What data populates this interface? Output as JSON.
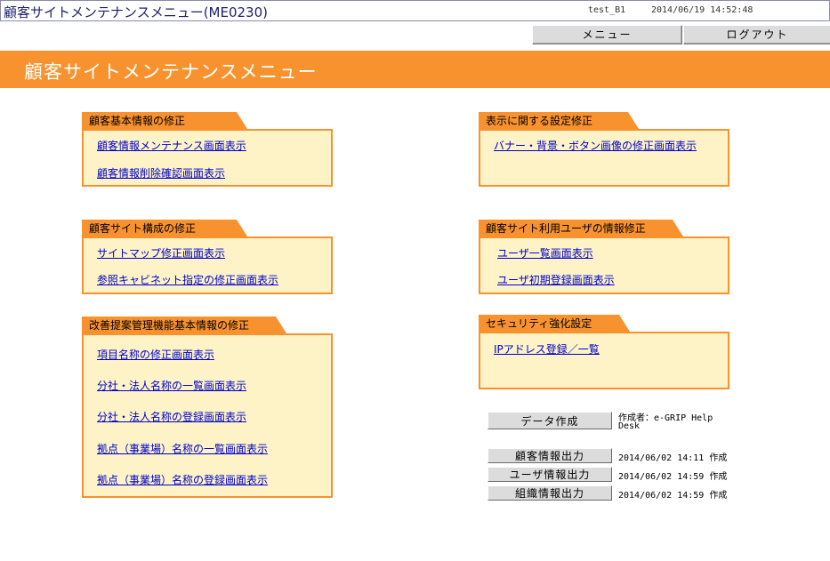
{
  "header": {
    "title": "顧客サイトメンテナンスメニュー(ME0230)",
    "user": "test_B1",
    "datetime": "2014/06/19  14:52:48"
  },
  "nav": {
    "menu_label": "メニュー",
    "logout_label": "ログアウト"
  },
  "page_title": "顧客サイトメンテナンスメニュー",
  "sections": {
    "customer_basic": {
      "title": "顧客基本情報の修正",
      "links": [
        "顧客情報メンテナンス画面表示",
        "顧客情報削除確認画面表示"
      ]
    },
    "site_structure": {
      "title": "顧客サイト構成の修正",
      "links": [
        "サイトマップ修正画面表示",
        "参照キャビネット指定の修正画面表示"
      ]
    },
    "kaizen": {
      "title": "改善提案管理機能基本情報の修正",
      "links": [
        "項目名称の修正画面表示",
        "分社・法人名称の一覧画面表示",
        "分社・法人名称の登録画面表示",
        "拠点（事業場）名称の一覧画面表示",
        "拠点（事業場）名称の登録画面表示"
      ]
    },
    "display": {
      "title": "表示に関する設定修正",
      "links": [
        "バナー・背景・ボタン画像の修正画面表示"
      ]
    },
    "users": {
      "title": "顧客サイト利用ユーザの情報修正",
      "links": [
        "ユーザ一覧画面表示",
        "ユーザ初期登録画面表示"
      ]
    },
    "security": {
      "title": "セキュリティ強化設定",
      "links": [
        "IPアドレス登録／一覧"
      ]
    }
  },
  "data_output": {
    "create_label": "データ作成",
    "creator_line1": "作成者：e-GRIP Help",
    "creator_line2": "Desk",
    "rows": [
      {
        "label": "顧客情報出力",
        "info": "2014/06/02 14:11 作成"
      },
      {
        "label": "ユーザ情報出力",
        "info": "2014/06/02 14:59 作成"
      },
      {
        "label": "組織情報出力",
        "info": "2014/06/02 14:59 作成"
      }
    ]
  },
  "colors": {
    "accent": "#f8922e",
    "panel": "#fdf3c6",
    "link": "#0000cc"
  }
}
